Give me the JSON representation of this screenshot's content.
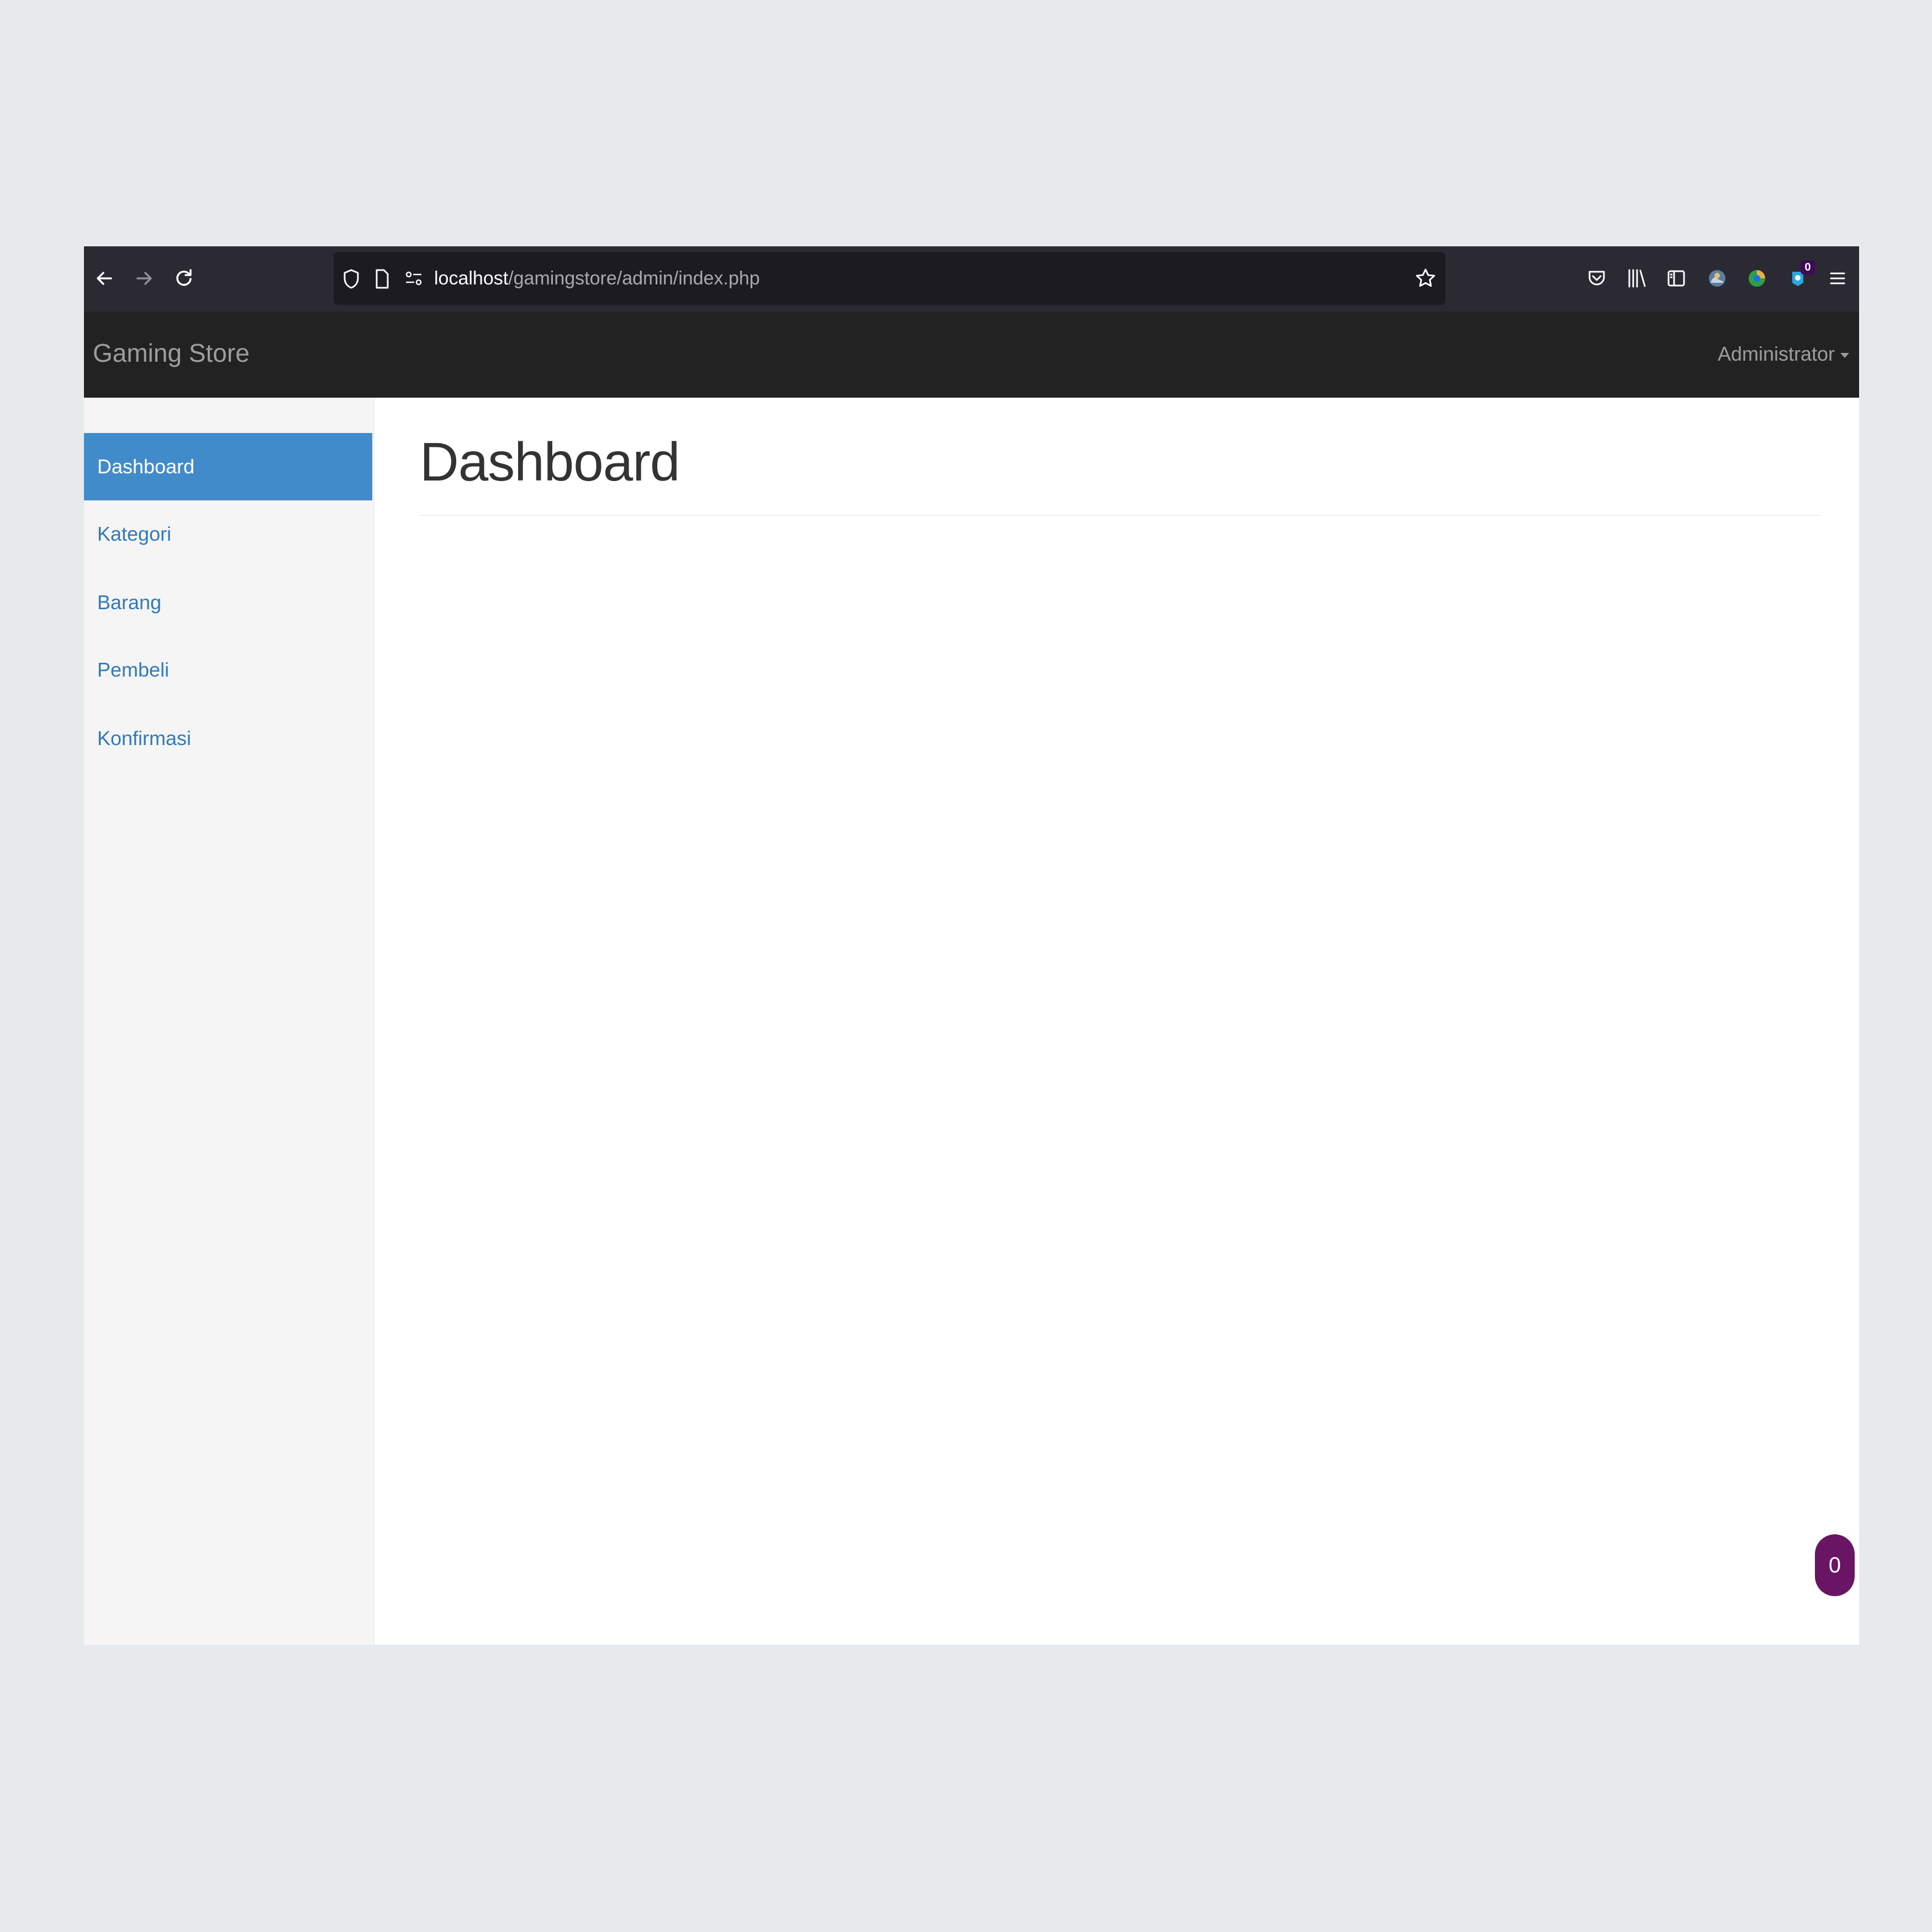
{
  "browser": {
    "url_host": "localhost",
    "url_path": "/gamingstore/admin/index.php",
    "extension_badge": "0",
    "icons": [
      "back-icon",
      "forward-icon",
      "reload-icon",
      "shield-icon",
      "page-icon",
      "permissions-icon",
      "star-icon",
      "pocket-icon",
      "library-icon",
      "sidebar-icon",
      "extension-icon",
      "extension-icon",
      "extension-icon",
      "menu-icon"
    ]
  },
  "navbar": {
    "brand": "Gaming Store",
    "user": "Administrator"
  },
  "sidebar": {
    "items": [
      {
        "label": "Dashboard",
        "active": true
      },
      {
        "label": "Kategori",
        "active": false
      },
      {
        "label": "Barang",
        "active": false
      },
      {
        "label": "Pembeli",
        "active": false
      },
      {
        "label": "Konfirmasi",
        "active": false
      }
    ]
  },
  "main": {
    "title": "Dashboard"
  },
  "floating_badge": "0",
  "colors": {
    "toolbar_bg": "#2b2a33",
    "navbar_bg": "#222222",
    "active_item": "#428bca",
    "link": "#337ab7",
    "floating_badge": "#6a1464"
  }
}
